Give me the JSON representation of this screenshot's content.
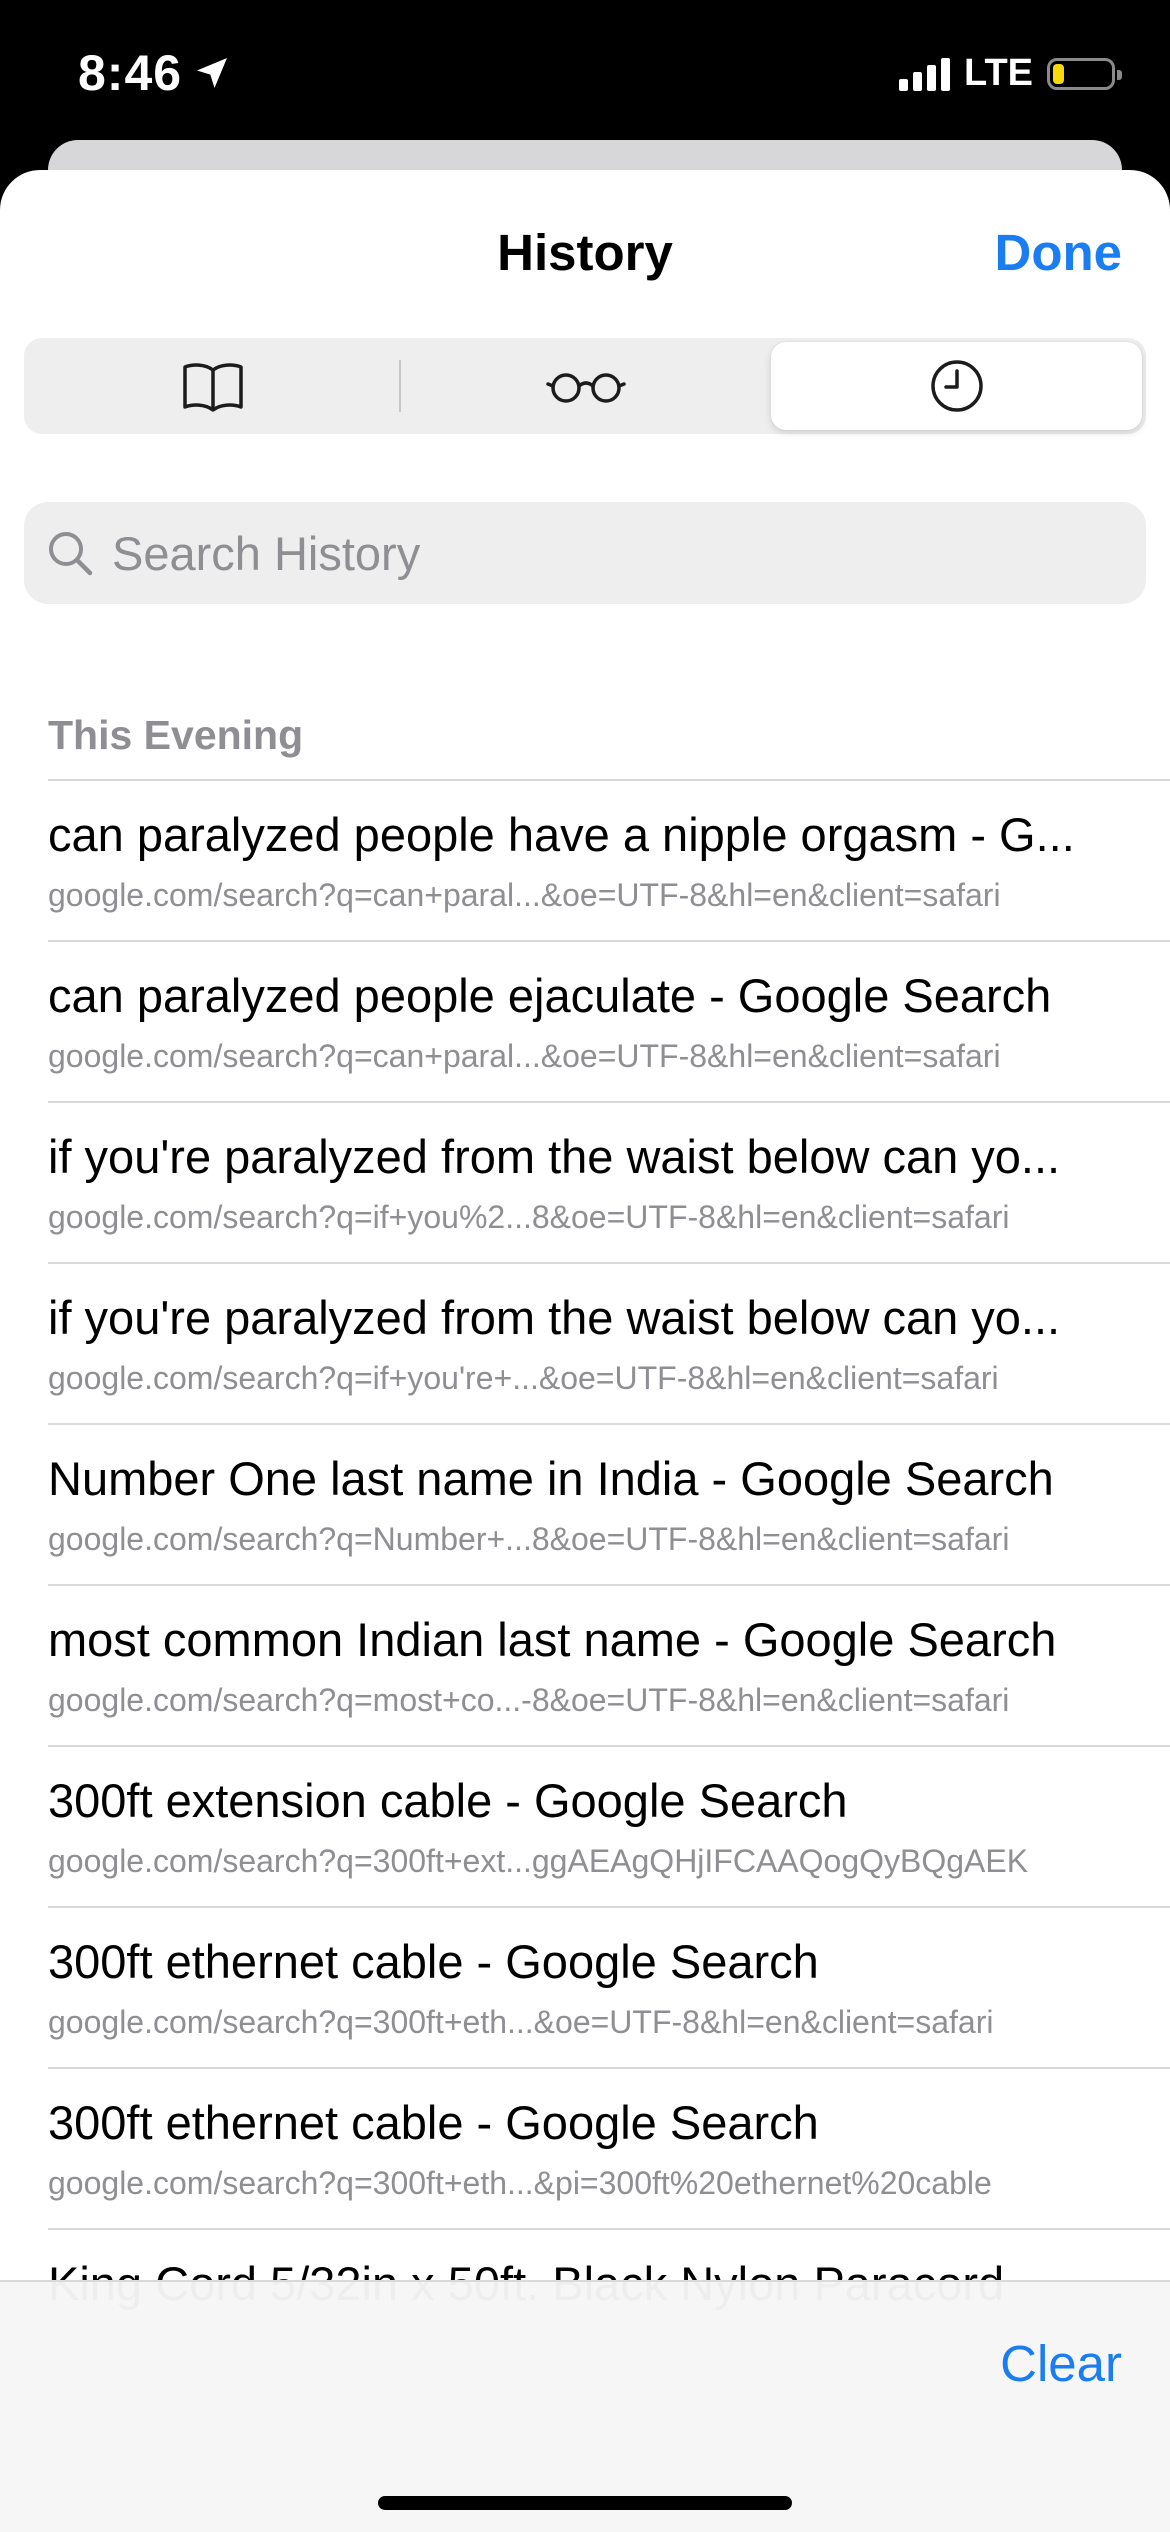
{
  "status_bar": {
    "time": "8:46",
    "network": "LTE",
    "battery_level": 0.2,
    "battery_color": "#f5d90a",
    "location_icon": "location-arrow-icon"
  },
  "nav": {
    "title": "History",
    "done_label": "Done",
    "accent_color": "#1b7ef0"
  },
  "segments": [
    {
      "icon": "book-icon",
      "selected": false
    },
    {
      "icon": "glasses-icon",
      "selected": false
    },
    {
      "icon": "clock-icon",
      "selected": true
    }
  ],
  "search": {
    "placeholder": "Search History",
    "value": ""
  },
  "section": {
    "title": "This Evening"
  },
  "history": [
    {
      "title": "can paralyzed people have a nipple orgasm - G...",
      "url": "google.com/search?q=can+paral...&oe=UTF-8&hl=en&client=safari"
    },
    {
      "title": "can paralyzed people ejaculate - Google Search",
      "url": "google.com/search?q=can+paral...&oe=UTF-8&hl=en&client=safari"
    },
    {
      "title": "if you're paralyzed from the waist below can yo...",
      "url": "google.com/search?q=if+you%2...8&oe=UTF-8&hl=en&client=safari"
    },
    {
      "title": "if you're paralyzed from the waist below can yo...",
      "url": "google.com/search?q=if+you're+...&oe=UTF-8&hl=en&client=safari"
    },
    {
      "title": "Number One last name in India - Google Search",
      "url": "google.com/search?q=Number+...8&oe=UTF-8&hl=en&client=safari"
    },
    {
      "title": "most common Indian last name - Google Search",
      "url": "google.com/search?q=most+co...-8&oe=UTF-8&hl=en&client=safari"
    },
    {
      "title": "300ft extension cable - Google Search",
      "url": "google.com/search?q=300ft+ext...ggAEAgQHjIFCAAQogQyBQgAEK"
    },
    {
      "title": "300ft ethernet cable - Google Search",
      "url": "google.com/search?q=300ft+eth...&oe=UTF-8&hl=en&client=safari"
    },
    {
      "title": "300ft ethernet cable - Google Search",
      "url": "google.com/search?q=300ft+eth...&pi=300ft%20ethernet%20cable"
    },
    {
      "title": "King Cord 5/32in x 50ft. Black Nylon Paracord",
      "url": ""
    }
  ],
  "toolbar": {
    "clear_label": "Clear"
  }
}
